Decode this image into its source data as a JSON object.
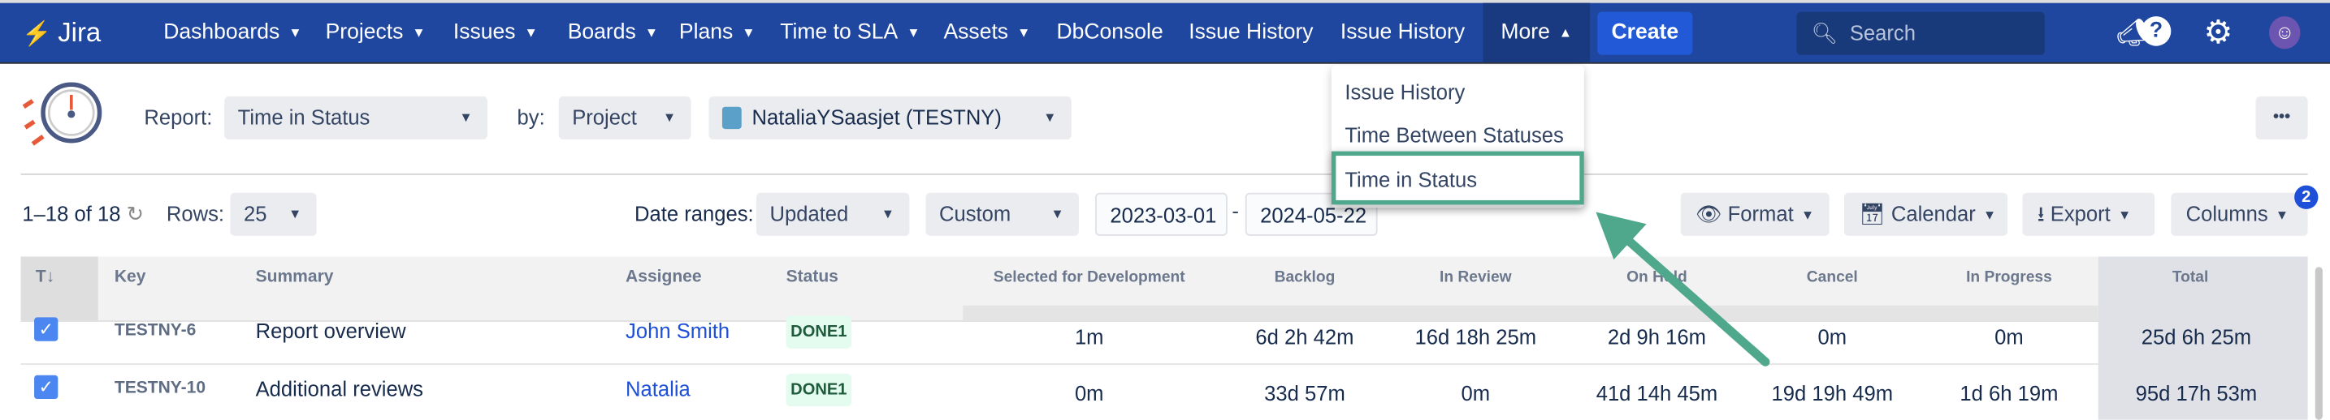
{
  "nav": {
    "logo": "Jira",
    "items": [
      {
        "label": "Dashboards",
        "dropdown": true
      },
      {
        "label": "Projects",
        "dropdown": true
      },
      {
        "label": "Issues",
        "dropdown": true
      },
      {
        "label": "Boards",
        "dropdown": true
      },
      {
        "label": "Plans",
        "dropdown": true
      },
      {
        "label": "Time to SLA",
        "dropdown": true
      },
      {
        "label": "Assets",
        "dropdown": true
      },
      {
        "label": "DbConsole",
        "dropdown": false
      },
      {
        "label": "Issue History",
        "dropdown": false
      },
      {
        "label": "Issue History",
        "dropdown": false
      }
    ],
    "more_label": "More",
    "create_label": "Create",
    "search_placeholder": "Search",
    "icons": [
      "megaphone-icon",
      "help-icon",
      "gear-icon",
      "avatar"
    ],
    "brand_color": "#1f47a0"
  },
  "more_menu": {
    "items": [
      {
        "label": "Issue History"
      },
      {
        "label": "Time Between Statuses"
      },
      {
        "label": "Time in Status",
        "highlighted": true
      }
    ],
    "highlight_color": "#4fa88b"
  },
  "report_bar": {
    "report_label": "Report:",
    "report_value": "Time in Status",
    "by_label": "by:",
    "by_value": "Project",
    "project_value": "NataliaYSaasjet (TESTNY)",
    "more_actions": "•••"
  },
  "toolbar": {
    "range_text": "1–18 of 18",
    "rows_label": "Rows:",
    "rows_value": "25",
    "date_ranges_label": "Date ranges:",
    "date_field": "Updated",
    "date_mode": "Custom",
    "date_from": "2023-03-01",
    "date_sep": "-",
    "date_to": "2024-05-22",
    "format_label": "Format",
    "calendar_label": "Calendar",
    "export_label": "Export",
    "columns_label": "Columns",
    "columns_badge": "2"
  },
  "table": {
    "headers": [
      "T↓",
      "Key",
      "Summary",
      "Assignee",
      "Status",
      "Selected for Development",
      "Backlog",
      "In Review",
      "On Hold",
      "Cancel",
      "In Progress",
      "Total"
    ],
    "rows": [
      {
        "checked": true,
        "key": "TESTNY-6",
        "summary": "Report overview",
        "assignee": "John Smith",
        "status": "DONE1",
        "values": [
          "1m",
          "6d 2h 42m",
          "16d 18h 25m",
          "2d 9h 16m",
          "0m",
          "0m"
        ],
        "total": "25d 6h 25m"
      },
      {
        "checked": true,
        "key": "TESTNY-10",
        "summary": "Additional reviews",
        "assignee": "Natalia",
        "status": "DONE1",
        "values": [
          "0m",
          "33d 57m",
          "0m",
          "41d 14h 45m",
          "19d 19h 49m",
          "1d 6h 19m"
        ],
        "total": "95d 17h 53m"
      }
    ]
  }
}
